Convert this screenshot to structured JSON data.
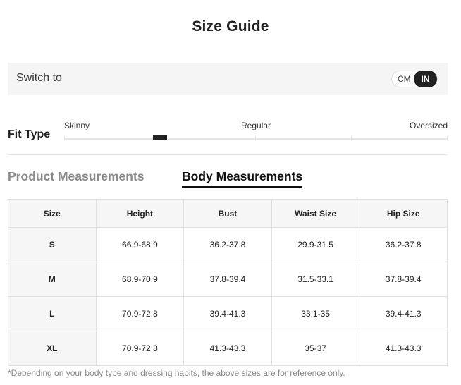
{
  "title": "Size Guide",
  "switch": {
    "label": "Switch to",
    "options": [
      "CM",
      "IN"
    ],
    "selected": "IN"
  },
  "fit": {
    "label": "Fit Type",
    "scale": [
      "Skinny",
      "Regular",
      "Oversized"
    ],
    "position_percent": 25
  },
  "tabs": {
    "product": "Product Measurements",
    "body": "Body Measurements",
    "active": "Body Measurements"
  },
  "table": {
    "headers": [
      "Size",
      "Height",
      "Bust",
      "Waist Size",
      "Hip Size"
    ],
    "rows": [
      [
        "S",
        "66.9-68.9",
        "36.2-37.8",
        "29.9-31.5",
        "36.2-37.8"
      ],
      [
        "M",
        "68.9-70.9",
        "37.8-39.4",
        "31.5-33.1",
        "37.8-39.4"
      ],
      [
        "L",
        "70.9-72.8",
        "39.4-41.3",
        "33.1-35",
        "39.4-41.3"
      ],
      [
        "XL",
        "70.9-72.8",
        "41.3-43.3",
        "35-37",
        "41.3-43.3"
      ]
    ]
  },
  "footnote": "*Depending on your body type and dressing habits, the above sizes are for reference only."
}
